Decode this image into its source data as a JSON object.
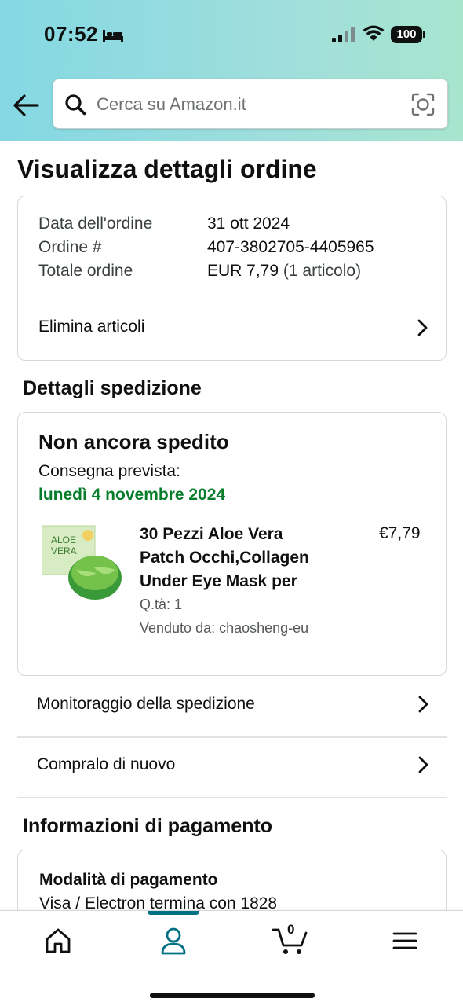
{
  "status_bar": {
    "time": "07:52",
    "battery": "100"
  },
  "search": {
    "placeholder": "Cerca su Amazon.it"
  },
  "page_title": "Visualizza dettagli ordine",
  "order_summary": {
    "date_label": "Data dell'ordine",
    "date_value": "31 ott 2024",
    "number_label": "Ordine #",
    "number_value": "407-3802705-4405965",
    "total_label": "Totale ordine",
    "total_value": "EUR 7,79",
    "total_items": "(1 articolo)",
    "delete_items_label": "Elimina articoli"
  },
  "shipping": {
    "section_title": "Dettagli spedizione",
    "status": "Non ancora spedito",
    "delivery_label": "Consegna prevista:",
    "delivery_date": "lunedì 4 novembre 2024",
    "product": {
      "title_line1": "30 Pezzi Aloe Vera",
      "title_line2": "Patch Occhi,Collagen",
      "title_line3": "Under Eye Mask per",
      "price": "€7,79",
      "qty": "Q.tà: 1",
      "seller": "Venduto da: chaosheng-eu",
      "image_text_line1": "ALOE",
      "image_text_line2": "VERA"
    }
  },
  "actions": {
    "track_label": "Monitoraggio della spedizione",
    "buy_again_label": "Compralo di nuovo"
  },
  "payment": {
    "section_title": "Informazioni di pagamento",
    "method_title": "Modalità di pagamento",
    "method_value": "Visa / Electron termina con 1828"
  },
  "bottom_nav": {
    "items": [
      "home-icon",
      "account-icon",
      "cart-icon",
      "menu-icon"
    ],
    "cart_count": "0",
    "active": "account-icon"
  },
  "colors": {
    "header_gradient_start": "#84d8e3",
    "header_gradient_end": "#a8e5cf",
    "delivery_green": "#067d2a",
    "active_nav_teal": "#007185"
  }
}
